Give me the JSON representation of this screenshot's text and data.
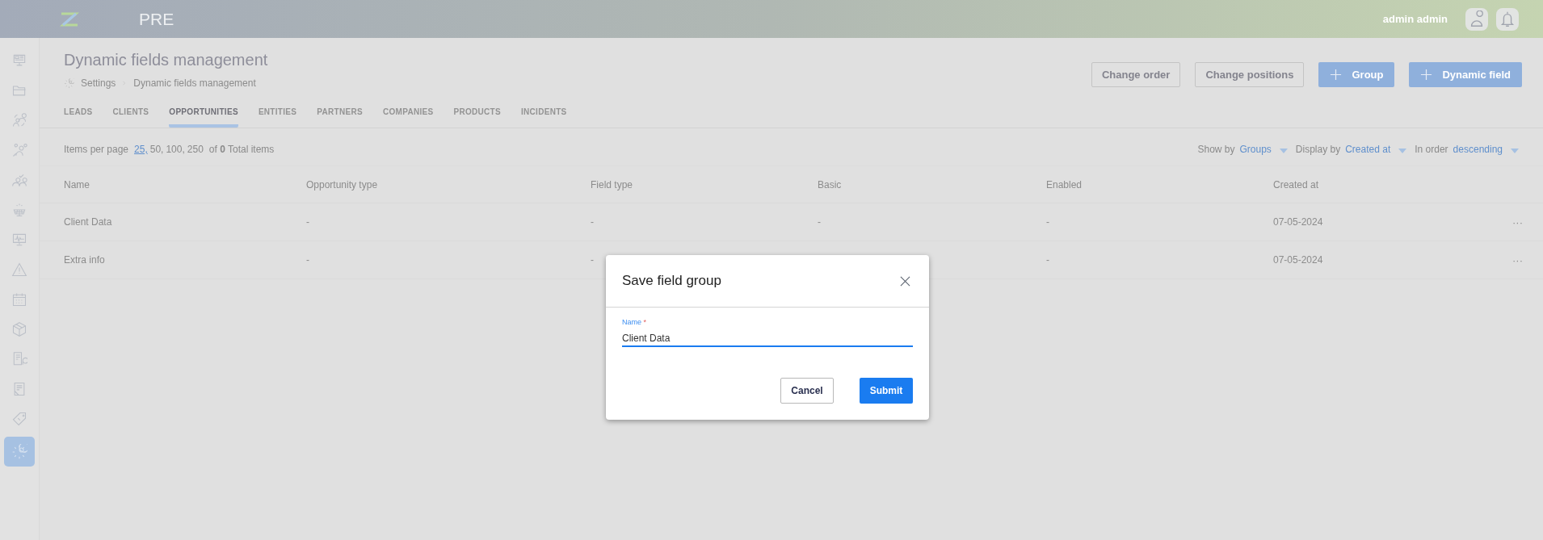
{
  "header": {
    "app_label": "PRE",
    "user_name": "admin admin"
  },
  "sidebar": {
    "items": [
      {
        "selected": false
      },
      {
        "selected": false
      },
      {
        "selected": false
      },
      {
        "selected": false
      },
      {
        "selected": false
      },
      {
        "selected": false
      },
      {
        "selected": false
      },
      {
        "selected": false
      },
      {
        "selected": false
      },
      {
        "selected": false
      },
      {
        "selected": false
      },
      {
        "selected": false
      },
      {
        "selected": false
      },
      {
        "selected": true
      }
    ]
  },
  "page": {
    "title": "Dynamic fields management",
    "breadcrumb": [
      "Settings",
      "Dynamic fields management"
    ],
    "actions": [
      {
        "label": "Change order",
        "kind": "outline"
      },
      {
        "label": "Change positions",
        "kind": "outline"
      },
      {
        "label": "Group",
        "kind": "primary"
      },
      {
        "label": "Dynamic field",
        "kind": "primary"
      }
    ]
  },
  "tabs": [
    {
      "label": "LEADS",
      "selected": false
    },
    {
      "label": "CLIENTS",
      "selected": false
    },
    {
      "label": "OPPORTUNITIES",
      "selected": true
    },
    {
      "label": "ENTITIES",
      "selected": false
    },
    {
      "label": "PARTNERS",
      "selected": false
    },
    {
      "label": "COMPANIES",
      "selected": false
    },
    {
      "label": "PRODUCTS",
      "selected": false
    },
    {
      "label": "INCIDENTS",
      "selected": false
    }
  ],
  "pagination": {
    "label": "Items per page",
    "options": [
      {
        "label": "25,",
        "selected": true
      },
      {
        "label": "50,",
        "selected": false
      },
      {
        "label": "100,",
        "selected": false
      },
      {
        "label": "250",
        "selected": false
      }
    ],
    "total": "of **0** Total items"
  },
  "filters": [
    {
      "label": "Show by",
      "value": "Groups"
    },
    {
      "label": "Display by",
      "value": "Created at"
    },
    {
      "label": "In order",
      "value": "descending"
    }
  ],
  "table": {
    "columns": [
      "Name",
      "Opportunity type",
      "Field type",
      "Basic",
      "Enabled",
      "Created at"
    ],
    "rows": [
      {
        "cells": {
          "name": "Client Data",
          "opportunity_type": "-",
          "field_type": "-",
          "basic": "-",
          "enabled": "-",
          "created_at": "07-05-2024"
        },
        "action": "···"
      },
      {
        "cells": {
          "name": "Extra info",
          "opportunity_type": "-",
          "field_type": "-",
          "enabled": "-",
          "created_at": "07-05-2024"
        },
        "action": "···"
      }
    ]
  },
  "modal": {
    "title": "Save field group",
    "field": {
      "label": "Name",
      "required_mark": "*",
      "value": "Client Data",
      "focused": true
    },
    "buttons": [
      {
        "label": "Cancel",
        "kind": "outline"
      },
      {
        "label": "Submit",
        "kind": "primary"
      }
    ]
  }
}
